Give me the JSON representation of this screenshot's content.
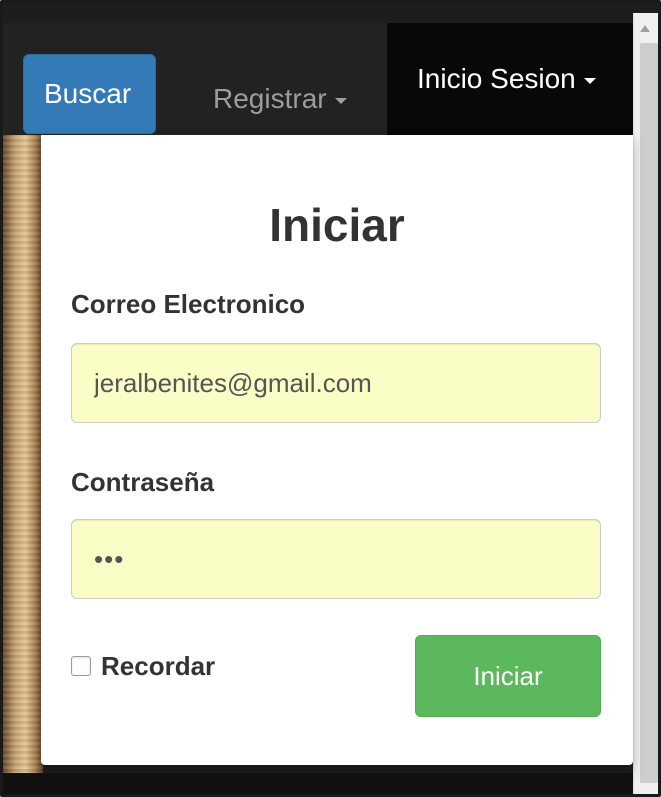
{
  "navbar": {
    "search_button": "Buscar",
    "register_menu": "Registrar",
    "login_menu": "Inicio Sesion"
  },
  "login_form": {
    "title": "Iniciar",
    "email_label": "Correo Electronico",
    "email_value": "jeralbenites@gmail.com",
    "password_label": "Contraseña",
    "password_value": "•••",
    "remember_label": "Recordar",
    "remember_checked": false,
    "submit_label": "Iniciar"
  },
  "colors": {
    "navbar_bg": "#222222",
    "active_nav_bg": "#080808",
    "primary_button": "#337ab7",
    "success_button": "#5cb85c",
    "autofill_input_bg": "#fafdc5"
  },
  "icons": {
    "dropdown_caret": "caret-down-icon",
    "scroll_up": "scroll-up-arrow-icon"
  }
}
